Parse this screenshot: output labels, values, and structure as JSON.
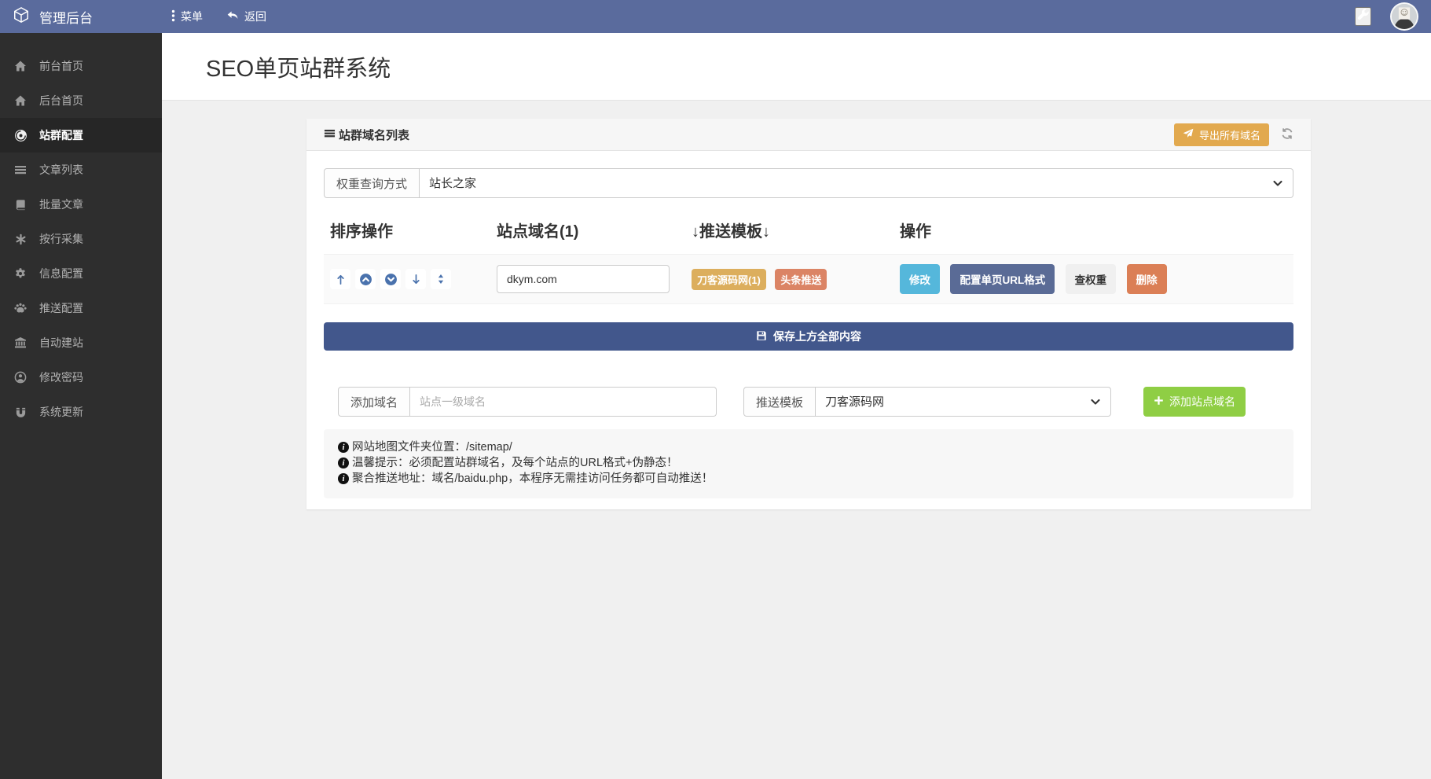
{
  "navbar": {
    "brand": "管理后台",
    "menu": "菜单",
    "back": "返回"
  },
  "sidebar": {
    "items": [
      {
        "label": "前台首页",
        "icon": "home-icon"
      },
      {
        "label": "后台首页",
        "icon": "home-icon"
      },
      {
        "label": "站群配置",
        "icon": "globe-icon",
        "active": true
      },
      {
        "label": "文章列表",
        "icon": "list-icon"
      },
      {
        "label": "批量文章",
        "icon": "book-icon"
      },
      {
        "label": "按行采集",
        "icon": "asterisk-icon"
      },
      {
        "label": "信息配置",
        "icon": "gear-icon"
      },
      {
        "label": "推送配置",
        "icon": "paw-icon"
      },
      {
        "label": "自动建站",
        "icon": "bank-icon"
      },
      {
        "label": "修改密码",
        "icon": "user-circle-icon"
      },
      {
        "label": "系统更新",
        "icon": "magnet-icon"
      }
    ]
  },
  "page": {
    "title": "SEO单页站群系统"
  },
  "panel": {
    "title": "站群域名列表",
    "export_button": "导出所有域名",
    "weight_query": {
      "label": "权重查询方式",
      "value": "站长之家"
    },
    "table": {
      "headers": [
        "排序操作",
        "站点域名(1)",
        "↓推送模板↓",
        "操作"
      ],
      "row": {
        "domain": "dkym.com",
        "badges": [
          "刀客源码网(1)",
          "头条推送"
        ],
        "actions": {
          "edit": "修改",
          "url_format": "配置单页URL格式",
          "check_weight": "查权重",
          "delete": "删除"
        }
      }
    },
    "save_button": "保存上方全部内容",
    "add_domain": {
      "label": "添加域名",
      "placeholder": "站点一级域名"
    },
    "push_template": {
      "label": "推送模板",
      "value": "刀客源码网"
    },
    "add_button": "添加站点域名",
    "notes": [
      "网站地图文件夹位置：/sitemap/",
      "温馨提示：必须配置站群域名，及每个站点的URL格式+伪静态！",
      "聚合推送地址：域名/baidu.php，本程序无需挂访问任务都可自动推送！"
    ]
  },
  "colors": {
    "navbar": "#5a6b9d",
    "sidebar": "#2e2e2e",
    "export_button": "#e2a94e",
    "badge_gold": "#dcae5d",
    "badge_orange": "#db8465",
    "btn_edit": "#55b7db",
    "btn_url_format": "#5a6b96",
    "btn_check_weight": "#f0f0f0",
    "btn_delete": "#db7f56",
    "btn_save": "#42578c",
    "btn_add": "#8fce44",
    "sort_icons": "#4a72ad"
  }
}
